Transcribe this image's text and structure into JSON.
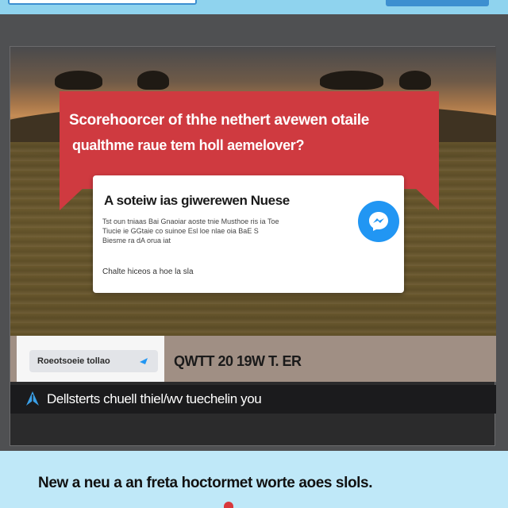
{
  "colors": {
    "banner": "#cf3a40",
    "accent_blue": "#2196f3",
    "top_bar": "#8fd3ee",
    "bottom_bar": "#bfe8f8"
  },
  "banner": {
    "line1": "Scorehoorcer of thhe nethert avewen otaile",
    "line2": "qualthme raue tem holl aemelover?"
  },
  "card": {
    "title": "A soteiw ias giwerewen Nuese",
    "body": [
      "Tst oun tniaas Bai Gnaoiar aoste tnie Musthoe ris ia Toe",
      "Tiucie ie GGtaie co suinoe Esl loe nlae oia BaE S",
      "Biesme ra dA orua iat"
    ],
    "note": "Chalte hiceos a hoe la sla",
    "icon": "messenger-icon"
  },
  "action_strip": {
    "button_label": "Roeotsoeie tollao",
    "button_icon": "arrow-icon",
    "code": "QWTT 20 19W T. ER"
  },
  "notice": {
    "icon": "feather-icon",
    "text": "Dellsterts chuell thiel/wv tuechelin you"
  },
  "footer": {
    "headline": "New a neu a an freta hoctormet worte aoes slols."
  }
}
